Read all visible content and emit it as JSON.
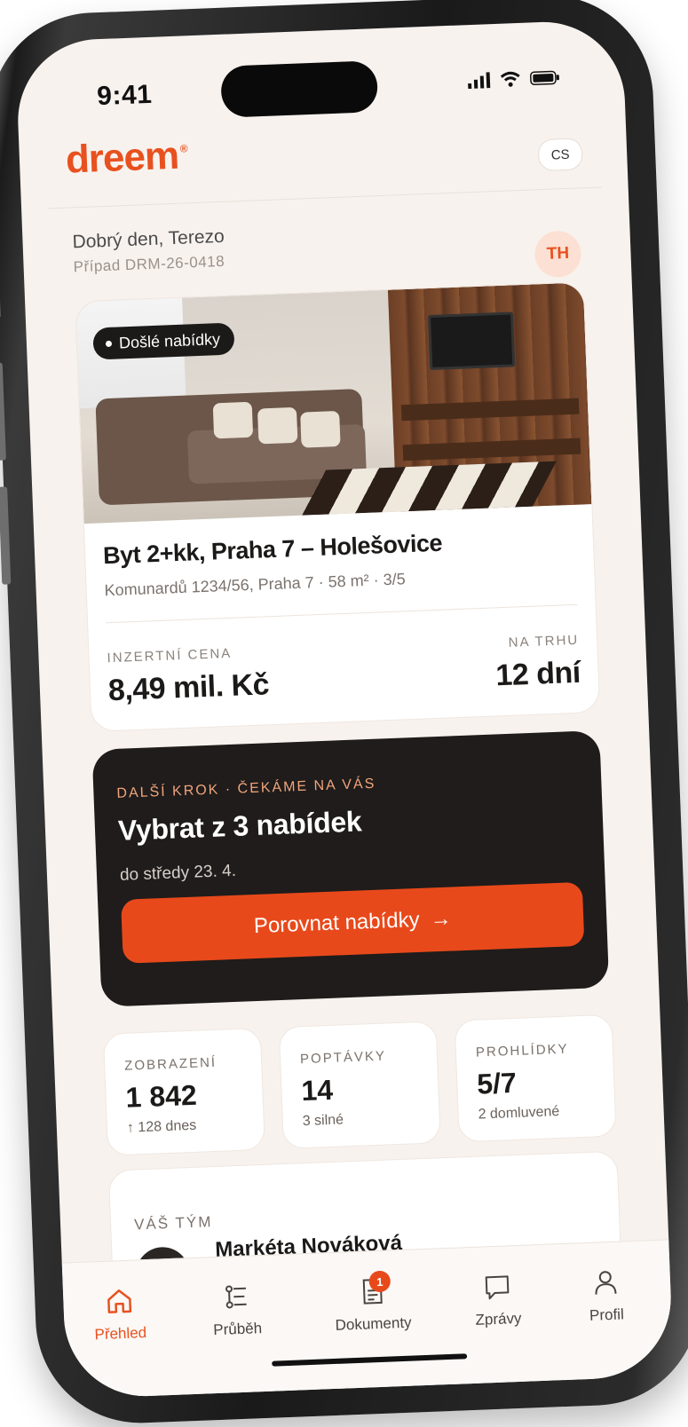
{
  "status_bar": {
    "time": "9:41"
  },
  "header": {
    "logo": "dreem",
    "logo_mark": "®",
    "language": "CS"
  },
  "user": {
    "greeting": "Dobrý den, Terezo",
    "case_id": "Případ DRM-26-0418",
    "initials": "TH"
  },
  "property": {
    "badge": "Došlé nabídky",
    "title": "Byt 2+kk, Praha 7 – Holešovice",
    "address": "Komunardů 1234/56, Praha 7 · 58 m² · 3/5",
    "price_label": "INZERTNÍ CENA",
    "price_value": "8,49 mil. Kč",
    "market_label": "NA TRHU",
    "market_value": "12 dní"
  },
  "next_step": {
    "label": "DALŠÍ KROK · ČEKÁME NA VÁS",
    "title": "Vybrat z 3 nabídek",
    "deadline": "do středy 23. 4.",
    "cta": "Porovnat nabídky",
    "cta_arrow": "→"
  },
  "stats": [
    {
      "label": "ZOBRAZENÍ",
      "value": "1 842",
      "sub": "↑ 128 dnes"
    },
    {
      "label": "POPTÁVKY",
      "value": "14",
      "sub": "3 silné"
    },
    {
      "label": "PROHLÍDKY",
      "value": "5/7",
      "sub": "2 domluvené"
    }
  ],
  "team": {
    "label": "VÁŠ TÝM",
    "member_name": "Markéta Nováková"
  },
  "tabs": [
    {
      "label": "Přehled",
      "icon": "home-icon",
      "active": true
    },
    {
      "label": "Průběh",
      "icon": "timeline-icon"
    },
    {
      "label": "Dokumenty",
      "icon": "document-icon",
      "badge": "1"
    },
    {
      "label": "Zprávy",
      "icon": "chat-icon"
    },
    {
      "label": "Profil",
      "icon": "user-icon"
    }
  ],
  "colors": {
    "accent": "#e8511f",
    "dark_card": "#1f1c1b",
    "background": "#f8f2ee"
  }
}
